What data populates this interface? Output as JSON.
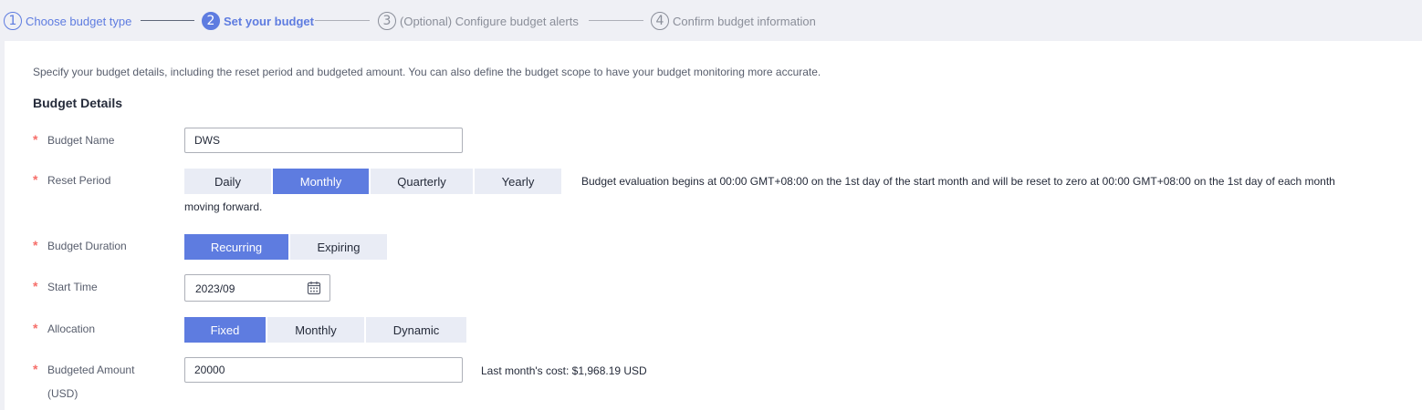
{
  "steps": [
    {
      "num": "1",
      "label": "Choose budget type",
      "state": "done"
    },
    {
      "num": "2",
      "label": "Set your budget",
      "state": "active"
    },
    {
      "num": "3",
      "label": "(Optional) Configure budget alerts",
      "state": "pending"
    },
    {
      "num": "4",
      "label": "Confirm budget information",
      "state": "pending"
    }
  ],
  "intro": "Specify your budget details, including the reset period and budgeted amount. You can also define the budget scope to have your budget monitoring more accurate.",
  "section_title": "Budget Details",
  "required_mark": "*",
  "fields": {
    "budget_name": {
      "label": "Budget Name",
      "value": "DWS"
    },
    "reset_period": {
      "label": "Reset Period",
      "options": [
        "Daily",
        "Monthly",
        "Quarterly",
        "Yearly"
      ],
      "selected": "Monthly",
      "hint_line1": "Budget evaluation begins at 00:00 GMT+08:00 on the 1st day of the start month and will be reset to zero at 00:00 GMT+08:00 on the 1st day of each month",
      "hint_line2": "moving forward."
    },
    "budget_duration": {
      "label": "Budget Duration",
      "options": [
        "Recurring",
        "Expiring"
      ],
      "selected": "Recurring"
    },
    "start_time": {
      "label": "Start Time",
      "value": "2023/09",
      "icon": "calendar-icon"
    },
    "allocation": {
      "label": "Allocation",
      "options": [
        "Fixed",
        "Monthly",
        "Dynamic"
      ],
      "selected": "Fixed"
    },
    "budgeted_amount": {
      "label_line1": "Budgeted Amount",
      "label_line2": "(USD)",
      "value": "20000",
      "hint": "Last month's cost: $1,968.19 USD"
    }
  },
  "colors": {
    "accent": "#5e7ce0",
    "required": "#f66f6a",
    "segment_bg": "#e9ecf5",
    "page_bg": "#eff0f5"
  }
}
